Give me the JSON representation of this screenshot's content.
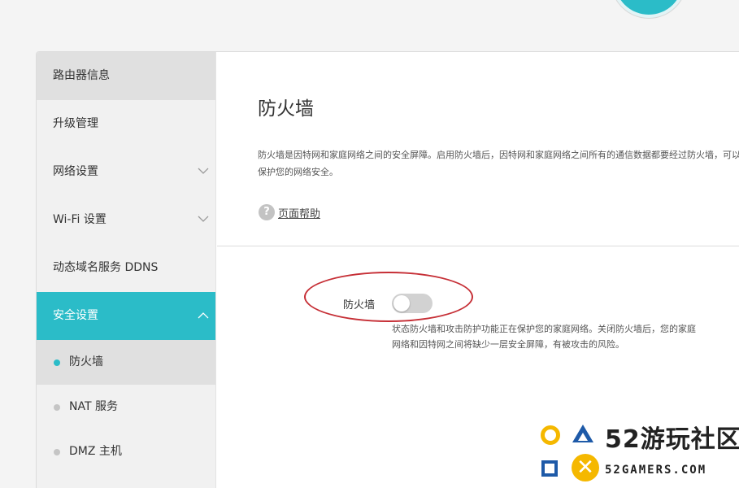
{
  "sidebar": {
    "items": [
      {
        "label": "路由器信息"
      },
      {
        "label": "升级管理"
      },
      {
        "label": "网络设置"
      },
      {
        "label": "Wi-Fi 设置"
      },
      {
        "label": "动态域名服务 DDNS"
      },
      {
        "label": "安全设置"
      }
    ],
    "sub_items": [
      {
        "label": "防火墙"
      },
      {
        "label": "NAT 服务"
      },
      {
        "label": "DMZ 主机"
      }
    ]
  },
  "main": {
    "title": "防火墙",
    "description": "防火墙是因特网和家庭网络之间的安全屏障。启用防火墙后，因特网和家庭网络之间所有的通信数据都要经过防火墙，可以有效保护您的网络安全。",
    "help_icon": "?",
    "help_label": "页面帮助",
    "toggle_label": "防火墙",
    "toggle_on": false,
    "status_text": "状态防火墙和攻击防护功能正在保护您的家庭网络。关闭防火墙后，您的家庭网络和因特网之间将缺少一层安全屏障，有被攻击的风险。"
  },
  "watermark": {
    "title": "52游玩社区",
    "subtitle": "52GAMERS.COM",
    "x_glyph": "✕"
  },
  "colors": {
    "accent": "#2bbcc8",
    "annotation": "#c62f36"
  }
}
